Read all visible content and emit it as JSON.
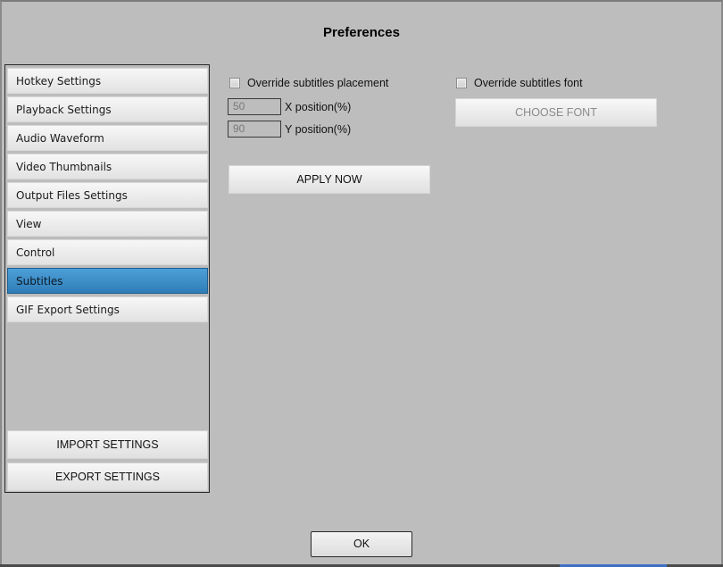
{
  "window": {
    "title": "Preferences"
  },
  "sidebar": {
    "items": [
      {
        "label": "Hotkey Settings",
        "active": false
      },
      {
        "label": "Playback Settings",
        "active": false
      },
      {
        "label": "Audio Waveform",
        "active": false
      },
      {
        "label": "Video Thumbnails",
        "active": false
      },
      {
        "label": "Output Files Settings",
        "active": false
      },
      {
        "label": "View",
        "active": false
      },
      {
        "label": "Control",
        "active": false
      },
      {
        "label": "Subtitles",
        "active": true
      },
      {
        "label": "GIF Export Settings",
        "active": false
      }
    ],
    "import_label": "IMPORT SETTINGS",
    "export_label": "EXPORT SETTINGS"
  },
  "subtitles": {
    "override_placement": {
      "label": "Override subtitles placement",
      "checked": false
    },
    "x_position": {
      "value": "50",
      "label": "X position(%)"
    },
    "y_position": {
      "value": "90",
      "label": "Y position(%)"
    },
    "apply_label": "APPLY NOW",
    "override_font": {
      "label": "Override subtitles font",
      "checked": false
    },
    "choose_font_label": "CHOOSE FONT"
  },
  "footer": {
    "ok_label": "OK"
  },
  "colors": {
    "active_item": "#3a8cc9",
    "background": "#bdbdbd"
  }
}
